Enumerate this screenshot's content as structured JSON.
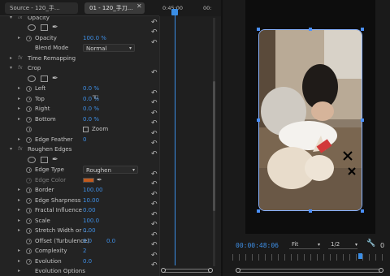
{
  "tabs": {
    "source": "Source - 120_手...",
    "clip": "01 - 120_手刀...",
    "close": "✕"
  },
  "timeline": {
    "time_left": "0:45:00",
    "time_right": "00:"
  },
  "effects": {
    "opacity_header": "Opacity",
    "opacity_label": "Opacity",
    "opacity_value": "100.0 %",
    "blend_label": "Blend Mode",
    "blend_value": "Normal",
    "time_remapping": "Time Remapping",
    "crop_header": "Crop",
    "crop_left_label": "Left",
    "crop_left_value": "0.0 %",
    "crop_top_label": "Top",
    "crop_top_value": "0.0 %",
    "crop_right_label": "Right",
    "crop_right_value": "0.0 %",
    "crop_bottom_label": "Bottom",
    "crop_bottom_value": "0.0 %",
    "zoom_label": "Zoom",
    "edge_feather_label": "Edge Feather",
    "edge_feather_value": "0",
    "roughen_header": "Roughen Edges",
    "edge_type_label": "Edge Type",
    "edge_type_value": "Roughen",
    "edge_color_label": "Edge Color",
    "border_label": "Border",
    "border_value": "100.00",
    "edge_sharpness_label": "Edge Sharpness",
    "edge_sharpness_value": "10.00",
    "fractal_label": "Fractal Influence",
    "fractal_value": "0.00",
    "scale_label": "Scale",
    "scale_value": "100.0",
    "stretch_label": "Stretch Width or ...",
    "stretch_value": "0.00",
    "offset_label": "Offset (Turbulence)",
    "offset_value_x": "0.0",
    "offset_value_y": "0.0",
    "complexity_label": "Complexity",
    "complexity_value": "2",
    "evolution_label": "Evolution",
    "evolution_value": "0.0",
    "evolution_options_label": "Evolution Options",
    "fx_badge": "fx"
  },
  "monitor": {
    "timecode": "00:00:48:06",
    "fit_value": "Fit",
    "resolution_value": "1/2",
    "timecode_right": "0"
  },
  "icons": {
    "reset": "reset-icon",
    "stopwatch": "stopwatch-icon",
    "wrench": "wrench-icon"
  },
  "colors": {
    "accent_blue": "#3e8fe6",
    "edge_color": "#c05a1e"
  }
}
